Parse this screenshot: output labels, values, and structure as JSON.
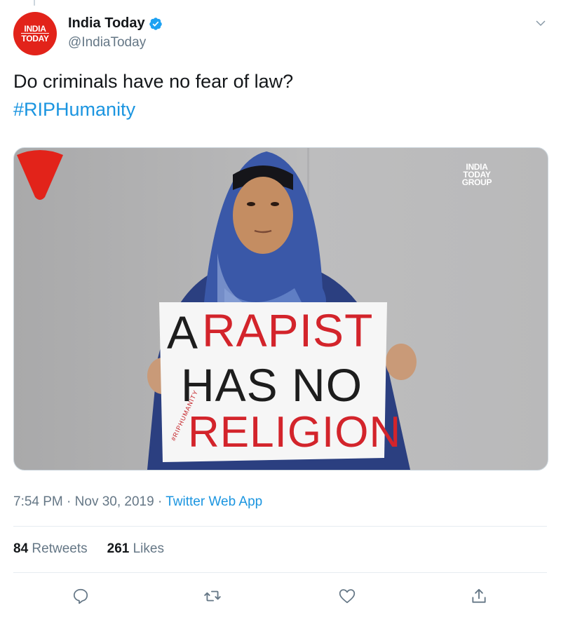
{
  "author": {
    "name": "India Today",
    "handle": "@IndiaToday",
    "avatar_lines": [
      "INDIA",
      "TODAY"
    ],
    "verified": true
  },
  "tweet": {
    "text": "Do criminals have no fear of law?",
    "hashtag": "#RIPHumanity"
  },
  "media": {
    "watermark_lines": [
      "INDIA",
      "TODAY",
      "GROUP"
    ],
    "placard": {
      "line1_black": "A",
      "line1_red": "RAPIST",
      "line2": "HAS NO",
      "line3": "RELIGION",
      "side_tag": "#RIPHUMANITY"
    }
  },
  "meta": {
    "time": "7:54 PM",
    "date": "Nov 30, 2019",
    "separator": "·",
    "source": "Twitter Web App"
  },
  "stats": {
    "retweets_count": "84",
    "retweets_label": "Retweets",
    "likes_count": "261",
    "likes_label": "Likes"
  },
  "colors": {
    "accent": "#1b95e0",
    "brand_red": "#e2231a",
    "muted": "#657786"
  },
  "actions": [
    "reply-icon",
    "retweet-icon",
    "like-icon",
    "share-icon"
  ]
}
